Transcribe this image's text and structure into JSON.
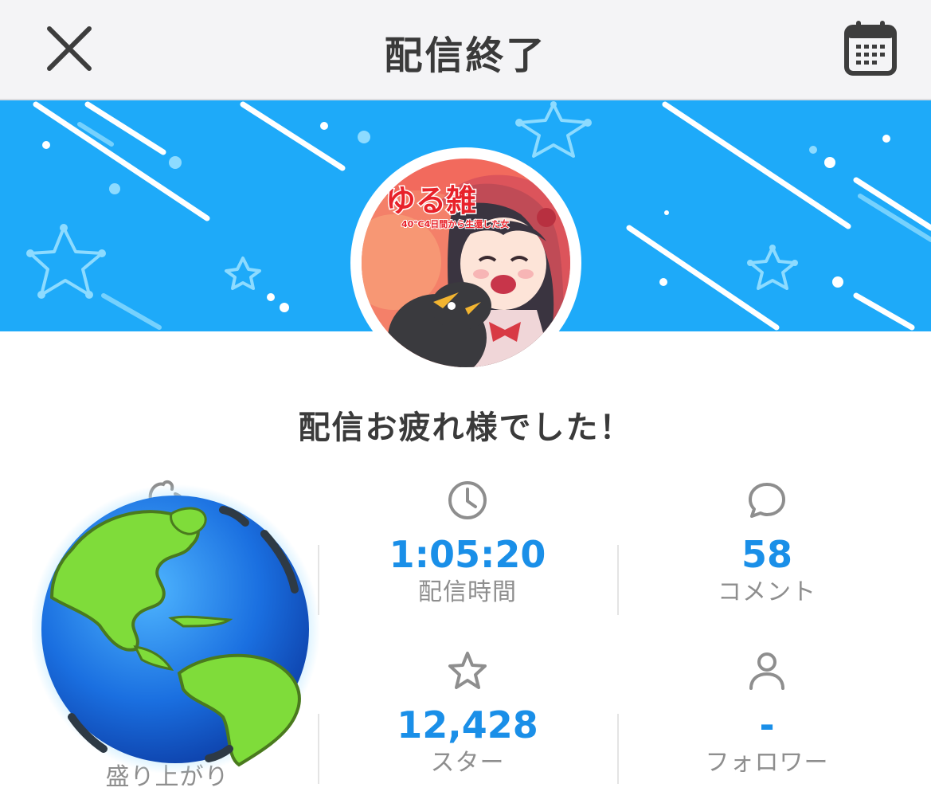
{
  "header": {
    "title": "配信終了",
    "close_icon": "close-icon",
    "calendar_icon": "calendar-icon"
  },
  "banner": {
    "color": "#1eaaf9",
    "avatar_title": "ゆる雑",
    "avatar_subtitle": "40℃4日間から生還した女"
  },
  "main": {
    "thanks_message": "配信お疲れ様でした！"
  },
  "stats": {
    "hype": {
      "label": "盛り上がり",
      "icon": "globe-icon"
    },
    "duration": {
      "value": "1:05:20",
      "label": "配信時間",
      "icon": "clock-icon"
    },
    "comments": {
      "value": "58",
      "label": "コメント",
      "icon": "comment-icon"
    },
    "stars": {
      "value": "12,428",
      "label": "スター",
      "icon": "star-icon"
    },
    "followers": {
      "value": "-",
      "label": "フォロワー",
      "icon": "person-icon"
    }
  },
  "colors": {
    "accent": "#1a8fe8",
    "label": "#8e8e8e",
    "title": "#3a3a3a"
  }
}
